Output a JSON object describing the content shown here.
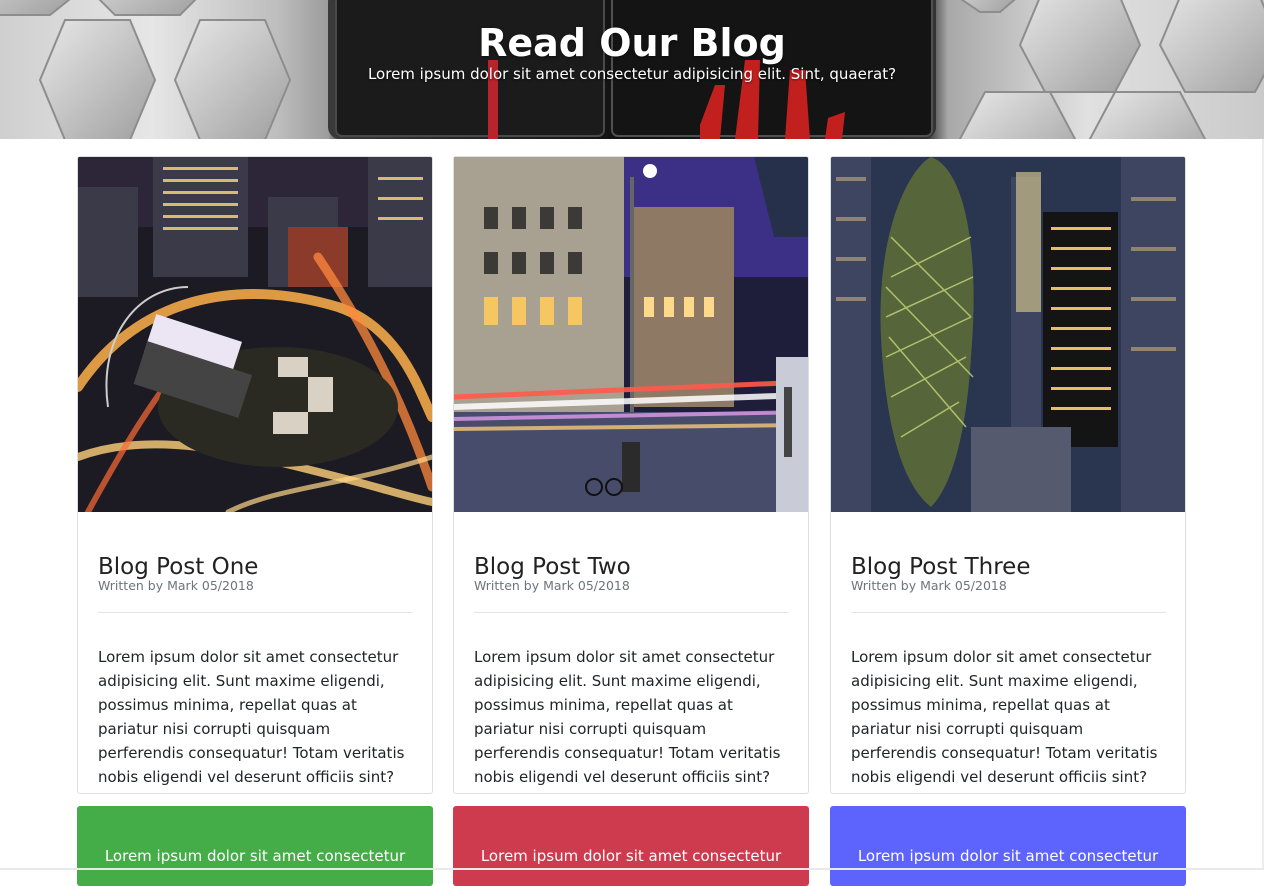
{
  "hero": {
    "title": "Read Our Blog",
    "subtitle": "Lorem ipsum dolor sit amet consectetur adipisicing elit. Sint, quaerat?"
  },
  "posts": [
    {
      "title": "Blog Post One",
      "meta": "Written by Mark 05/2018",
      "body": "Lorem ipsum dolor sit amet consectetur adipisicing elit. Sunt maxime eligendi, possimus minima, repellat quas at pariatur nisi corrupti quisquam perferendis consequatur! Totam veritatis nobis eligendi vel deserunt officiis sint?",
      "image": "city-night-roundabout-photo"
    },
    {
      "title": "Blog Post Two",
      "meta": "Written by Mark 05/2018",
      "body": "Lorem ipsum dolor sit amet consectetur adipisicing elit. Sunt maxime eligendi, possimus minima, repellat quas at pariatur nisi corrupti quisquam perferendis consequatur! Totam veritatis nobis eligendi vel deserunt officiis sint?",
      "image": "city-street-light-trails-photo"
    },
    {
      "title": "Blog Post Three",
      "meta": "Written by Mark 05/2018",
      "body": "Lorem ipsum dolor sit amet consectetur adipisicing elit. Sunt maxime eligendi, possimus minima, repellat quas at pariatur nisi corrupti quisquam perferendis consequatur! Totam veritatis nobis eligendi vel deserunt officiis sint?",
      "image": "skyscraper-aerial-night-photo"
    }
  ],
  "boxes": [
    {
      "text": "Lorem ipsum dolor sit amet consectetur",
      "color": "#44ad47"
    },
    {
      "text": "Lorem ipsum dolor sit amet consectetur",
      "color": "#cf3b4e"
    },
    {
      "text": "Lorem ipsum dolor sit amet consectetur",
      "color": "#5d63fd"
    }
  ]
}
